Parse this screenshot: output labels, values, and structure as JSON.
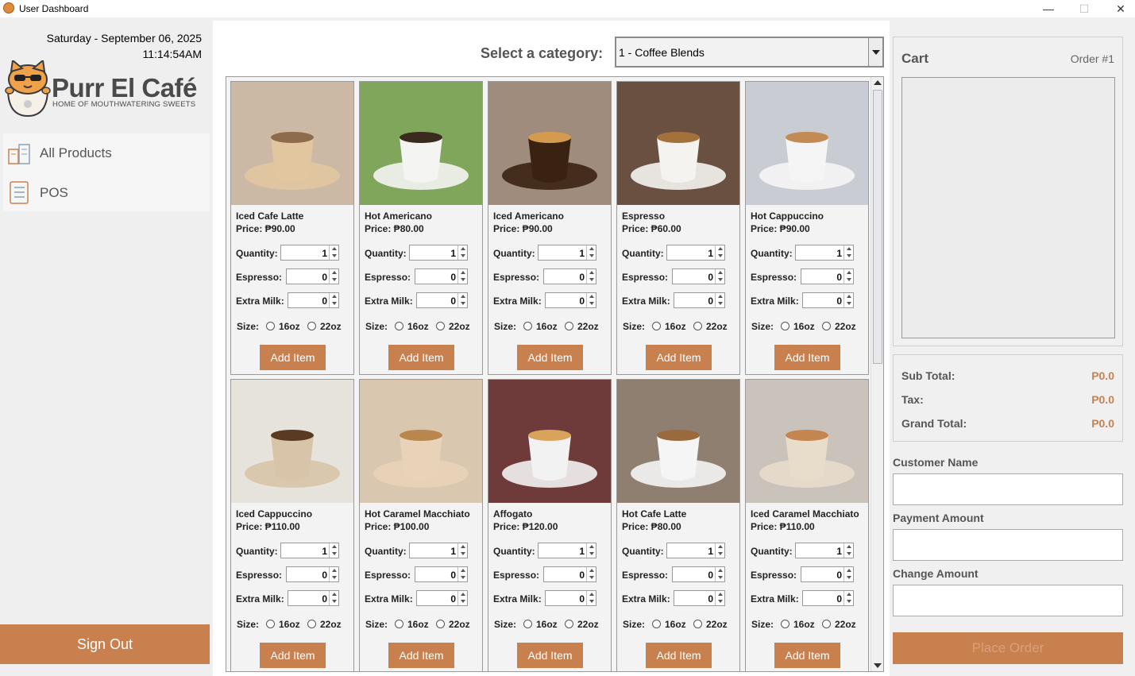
{
  "window": {
    "title": "User Dashboard",
    "minimize": "—",
    "maximize": "☐",
    "close": "✕"
  },
  "sidebar": {
    "date": "Saturday - September 06, 2025",
    "time": "11:14:54AM",
    "brand": "Purr El Café",
    "tagline": "HOME OF MOUTHWATERING SWEETS",
    "nav": [
      {
        "label": "All Products",
        "icon": "products-icon"
      },
      {
        "label": "POS",
        "icon": "pos-icon"
      }
    ],
    "sign_out": "Sign Out"
  },
  "main": {
    "category_label": "Select a category:",
    "category_value": "1 - Coffee Blends"
  },
  "labels": {
    "quantity": "Quantity:",
    "espresso": "Espresso:",
    "extra_milk": "Extra Milk:",
    "size": "Size:",
    "size_16": "16oz",
    "size_22": "22oz",
    "add_item": "Add Item"
  },
  "products": [
    {
      "name": "Iced Cafe Latte",
      "price": "Price: ₱90.00",
      "quantity": "1",
      "espresso": "0",
      "extra_milk": "0"
    },
    {
      "name": "Hot Americano",
      "price": "Price: ₱80.00",
      "quantity": "1",
      "espresso": "0",
      "extra_milk": "0"
    },
    {
      "name": "Iced Americano",
      "price": "Price: ₱90.00",
      "quantity": "1",
      "espresso": "0",
      "extra_milk": "0"
    },
    {
      "name": "Espresso",
      "price": "Price: ₱60.00",
      "quantity": "1",
      "espresso": "0",
      "extra_milk": "0"
    },
    {
      "name": "Hot Cappuccino",
      "price": "Price: ₱90.00",
      "quantity": "1",
      "espresso": "0",
      "extra_milk": "0"
    },
    {
      "name": "Iced Cappuccino",
      "price": "Price: ₱110.00",
      "quantity": "1",
      "espresso": "0",
      "extra_milk": "0"
    },
    {
      "name": "Hot Caramel Macchiato",
      "price": "Price: ₱100.00",
      "quantity": "1",
      "espresso": "0",
      "extra_milk": "0"
    },
    {
      "name": "Affogato",
      "price": "Price: ₱120.00",
      "quantity": "1",
      "espresso": "0",
      "extra_milk": "0"
    },
    {
      "name": "Hot Cafe Latte",
      "price": "Price: ₱80.00",
      "quantity": "1",
      "espresso": "0",
      "extra_milk": "0"
    },
    {
      "name": "Iced Caramel Macchiato",
      "price": "Price: ₱110.00",
      "quantity": "1",
      "espresso": "0",
      "extra_milk": "0"
    }
  ],
  "cart": {
    "title": "Cart",
    "order_number": "Order #1",
    "sub_total_label": "Sub Total:",
    "sub_total": "P0.0",
    "tax_label": "Tax:",
    "tax": "P0.0",
    "grand_total_label": "Grand Total:",
    "grand_total": "P0.0"
  },
  "form": {
    "customer_name_label": "Customer Name",
    "customer_name": "",
    "payment_amount_label": "Payment Amount",
    "payment_amount": "",
    "change_amount_label": "Change Amount",
    "change_amount": "",
    "place_order": "Place Order"
  },
  "colors": {
    "accent": "#c8804e",
    "text": "#555555"
  }
}
